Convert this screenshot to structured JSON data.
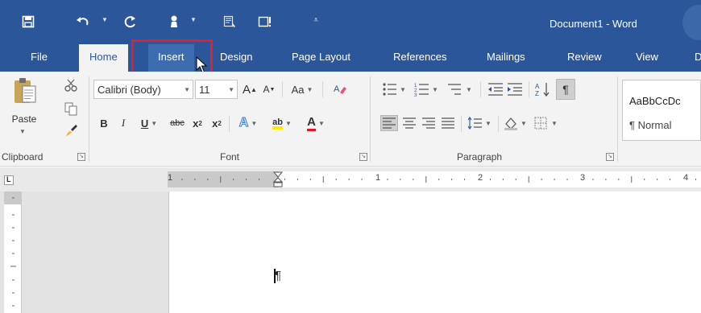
{
  "titlebar": {
    "document_title": "Document1 - Word",
    "quick_access": [
      {
        "name": "save-icon"
      },
      {
        "name": "undo-icon"
      },
      {
        "name": "redo-icon"
      },
      {
        "name": "touch-mode-icon"
      },
      {
        "name": "print-preview-icon"
      },
      {
        "name": "spelling-icon"
      },
      {
        "name": "customize-qat-icon"
      }
    ]
  },
  "tabs": {
    "file": "File",
    "home": "Home",
    "insert": "Insert",
    "design": "Design",
    "page_layout": "Page Layout",
    "references": "References",
    "mailings": "Mailings",
    "review": "Review",
    "view": "View",
    "overflow": "D"
  },
  "clipboard": {
    "paste_label": "Paste",
    "group_label": "Clipboard"
  },
  "font": {
    "font_name": "Calibri (Body)",
    "font_size": "11",
    "change_case_label": "Aa",
    "bold": "B",
    "italic": "I",
    "underline": "U",
    "strikethrough": "abc",
    "subscript": "x",
    "superscript": "x",
    "subscript_mark": "2",
    "superscript_mark": "2",
    "grow_font": "A",
    "shrink_font": "A",
    "font_color_letter": "A",
    "text_effects_letter": "A",
    "highlight_letters": "ab",
    "group_label": "Font"
  },
  "paragraph": {
    "group_label": "Paragraph",
    "show_hide_mark": "¶"
  },
  "styles": {
    "sample_text": "AaBbCcDc",
    "normal_label": "¶ Normal"
  },
  "ruler": {
    "corner_mark": "L",
    "labels": [
      "1",
      "1",
      "2",
      "3",
      "4"
    ]
  },
  "document": {
    "paragraph_mark": "¶"
  },
  "colors": {
    "word_blue": "#2b579a",
    "ribbon_bg": "#f3f3f3",
    "highlight_red": "#e0202e",
    "font_color_red": "#e81123",
    "highlight_yellow": "#ffeb00"
  }
}
